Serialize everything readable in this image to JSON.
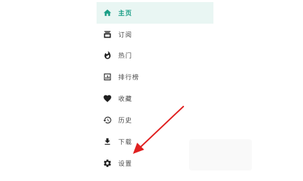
{
  "menu": {
    "items": [
      {
        "label": "主页",
        "icon": "home-icon",
        "active": true
      },
      {
        "label": "订阅",
        "icon": "subscription-icon",
        "active": false
      },
      {
        "label": "热门",
        "icon": "fire-icon",
        "active": false
      },
      {
        "label": "排行榜",
        "icon": "ranking-icon",
        "active": false
      },
      {
        "label": "收藏",
        "icon": "heart-icon",
        "active": false
      },
      {
        "label": "历史",
        "icon": "history-icon",
        "active": false
      },
      {
        "label": "下载",
        "icon": "download-icon",
        "active": false
      },
      {
        "label": "设置",
        "icon": "gear-icon",
        "active": false
      }
    ]
  },
  "colors": {
    "accent": "#1a9e86",
    "active_bg": "#e9f6f3",
    "icon": "#1f1f1f",
    "text": "#4a4a4a",
    "arrow": "#e02020"
  }
}
